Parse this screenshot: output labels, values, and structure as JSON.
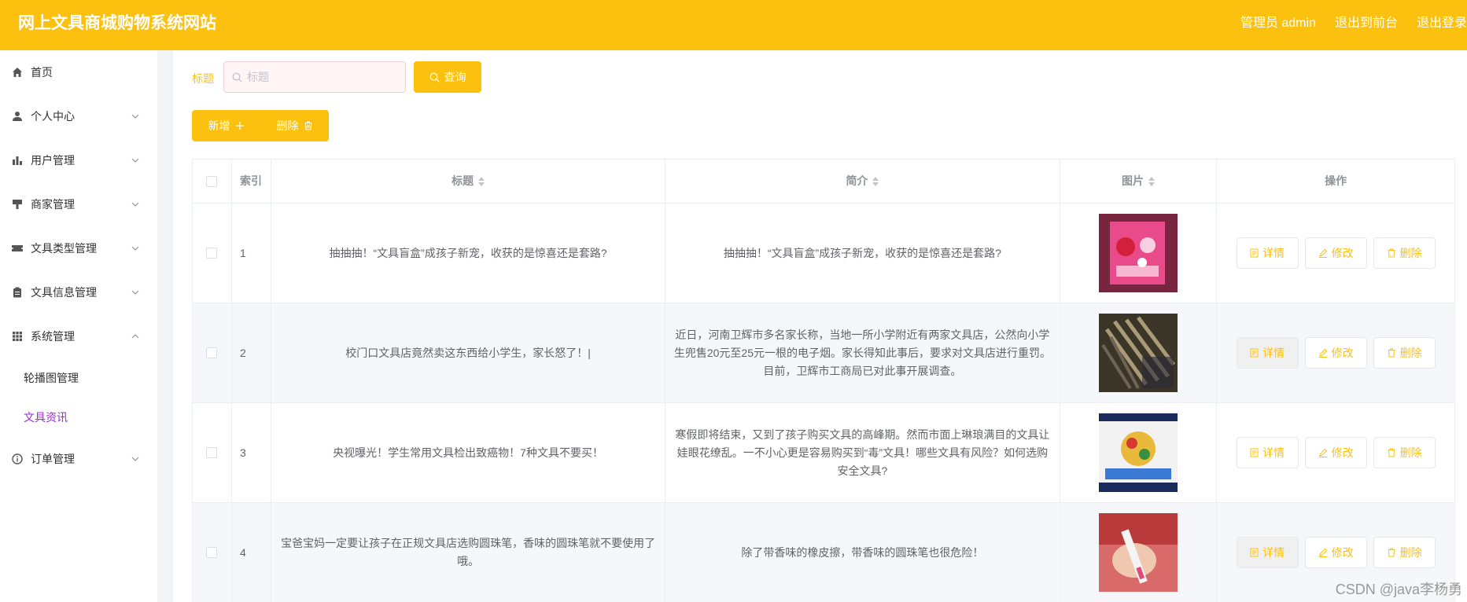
{
  "header": {
    "title": "网上文具商城购物系统网站",
    "admin": "管理员 admin",
    "back_front": "退出到前台",
    "logout": "退出登录"
  },
  "sidebar": {
    "items": [
      {
        "label": "首页",
        "icon": "home-icon"
      },
      {
        "label": "个人中心",
        "icon": "user-icon"
      },
      {
        "label": "用户管理",
        "icon": "chart-icon"
      },
      {
        "label": "商家管理",
        "icon": "shop-icon"
      },
      {
        "label": "文具类型管理",
        "icon": "ticket-icon"
      },
      {
        "label": "文具信息管理",
        "icon": "clipboard-icon"
      },
      {
        "label": "系统管理",
        "icon": "grid-icon"
      },
      {
        "label": "订单管理",
        "icon": "info-icon"
      }
    ],
    "submenu": [
      "轮播图管理",
      "文具资讯"
    ]
  },
  "search": {
    "label": "标题",
    "placeholder": "标题",
    "query_label": "查询"
  },
  "toolbar": {
    "add_label": "新增",
    "delete_label": "删除"
  },
  "table": {
    "headers": [
      "索引",
      "标题",
      "简介",
      "图片",
      "操作"
    ],
    "rows": [
      {
        "index": "1",
        "title": "抽抽抽！“文具盲盒”成孩子新宠，收获的是惊喜还是套路?",
        "intro": "抽抽抽！“文具盲盒”成孩子新宠，收获的是惊喜还是套路?"
      },
      {
        "index": "2",
        "title": "校门口文具店竟然卖这东西给小学生，家长怒了！|",
        "intro": "近日，河南卫辉市多名家长称，当地一所小学附近有两家文具店，公然向小学生兜售20元至25元一根的电子烟。家长得知此事后，要求对文具店进行重罚。目前，卫辉市工商局已对此事开展调查。"
      },
      {
        "index": "3",
        "title": "央视曝光！学生常用文具检出致癌物！7种文具不要买！",
        "intro": "寒假即将结束，又到了孩子购买文具的高峰期。然而市面上琳琅满目的文具让娃眼花缭乱。一不小心更是容易购买到“毒”文具！哪些文具有风险？如何选购安全文具?"
      },
      {
        "index": "4",
        "title": "宝爸宝妈一定要让孩子在正规文具店选购圆珠笔，香味的圆珠笔就不要使用了哦。",
        "intro": "除了带香味的橡皮擦，带香味的圆珠笔也很危险！"
      }
    ],
    "op_detail": "详情",
    "op_edit": "修改",
    "op_delete": "删除"
  },
  "watermark": "CSDN @java李杨勇",
  "colors": {
    "accent": "#fcc00f",
    "active_submenu": "#9c2bd8"
  }
}
